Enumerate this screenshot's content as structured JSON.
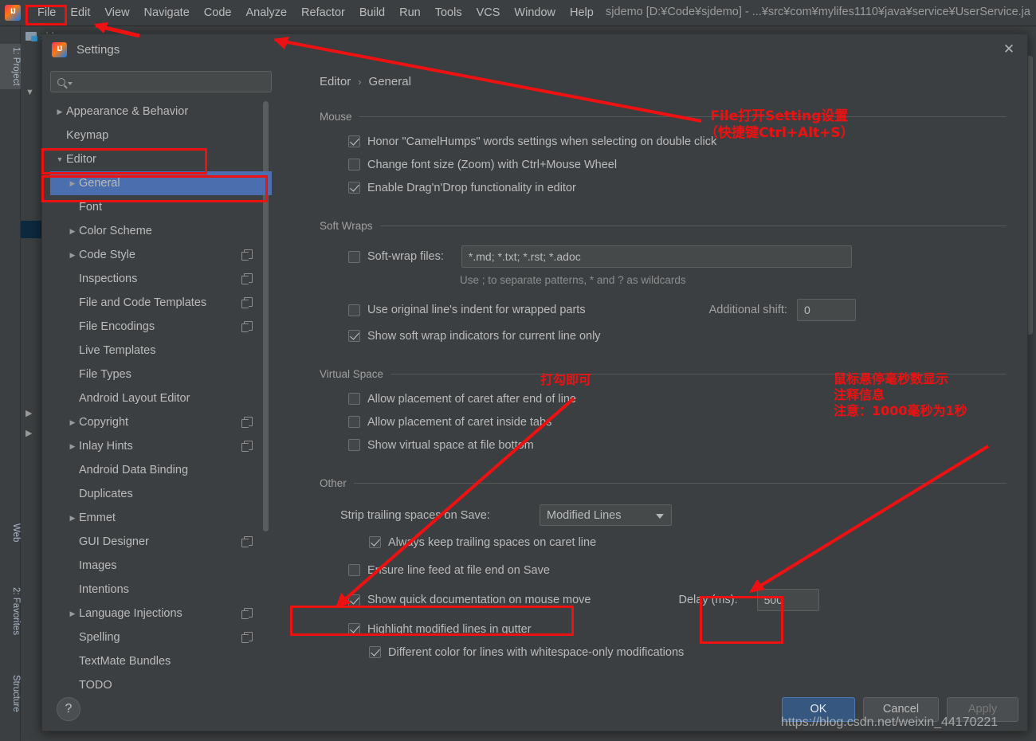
{
  "ide": {
    "menu": [
      {
        "label": "File",
        "mnemonic": "F"
      },
      {
        "label": "Edit",
        "mnemonic": "E"
      },
      {
        "label": "View",
        "mnemonic": "V"
      },
      {
        "label": "Navigate",
        "mnemonic": "N"
      },
      {
        "label": "Code",
        "mnemonic": "C"
      },
      {
        "label": "Analyze",
        "mnemonic": "z"
      },
      {
        "label": "Refactor",
        "mnemonic": "R"
      },
      {
        "label": "Build",
        "mnemonic": "B"
      },
      {
        "label": "Run",
        "mnemonic": "u"
      },
      {
        "label": "Tools",
        "mnemonic": "T"
      },
      {
        "label": "VCS",
        "mnemonic": ""
      },
      {
        "label": "Window",
        "mnemonic": "W"
      },
      {
        "label": "Help",
        "mnemonic": "H"
      }
    ],
    "window_title": "sjdemo [D:¥Code¥sjdemo] - ...¥src¥com¥mylifes1110¥java¥service¥UserService.ja",
    "project_tab_label": "sjd",
    "tool_windows": [
      {
        "label": "1: Project",
        "active": true
      },
      {
        "label": "Web",
        "active": false
      },
      {
        "label": "2: Favorites",
        "active": false
      },
      {
        "label": "Structure",
        "active": false
      }
    ]
  },
  "dialog": {
    "title": "Settings",
    "close_icon": "close-icon",
    "search": {
      "value": "",
      "placeholder": ""
    },
    "breadcrumb": {
      "root": "Editor",
      "separator": "›",
      "leaf": "General"
    },
    "tree": [
      {
        "label": "Appearance & Behavior",
        "depth": 0,
        "arrow": "▶",
        "copy": false,
        "selected": false
      },
      {
        "label": "Keymap",
        "depth": 0,
        "arrow": "",
        "copy": false,
        "selected": false
      },
      {
        "label": "Editor",
        "depth": 0,
        "arrow": "▼",
        "copy": false,
        "selected": false
      },
      {
        "label": "General",
        "depth": 1,
        "arrow": "▶",
        "copy": false,
        "selected": true
      },
      {
        "label": "Font",
        "depth": 1,
        "arrow": "",
        "copy": false,
        "selected": false
      },
      {
        "label": "Color Scheme",
        "depth": 1,
        "arrow": "▶",
        "copy": false,
        "selected": false
      },
      {
        "label": "Code Style",
        "depth": 1,
        "arrow": "▶",
        "copy": true,
        "selected": false
      },
      {
        "label": "Inspections",
        "depth": 1,
        "arrow": "",
        "copy": true,
        "selected": false
      },
      {
        "label": "File and Code Templates",
        "depth": 1,
        "arrow": "",
        "copy": true,
        "selected": false
      },
      {
        "label": "File Encodings",
        "depth": 1,
        "arrow": "",
        "copy": true,
        "selected": false
      },
      {
        "label": "Live Templates",
        "depth": 1,
        "arrow": "",
        "copy": false,
        "selected": false
      },
      {
        "label": "File Types",
        "depth": 1,
        "arrow": "",
        "copy": false,
        "selected": false
      },
      {
        "label": "Android Layout Editor",
        "depth": 1,
        "arrow": "",
        "copy": false,
        "selected": false
      },
      {
        "label": "Copyright",
        "depth": 1,
        "arrow": "▶",
        "copy": true,
        "selected": false
      },
      {
        "label": "Inlay Hints",
        "depth": 1,
        "arrow": "▶",
        "copy": true,
        "selected": false
      },
      {
        "label": "Android Data Binding",
        "depth": 1,
        "arrow": "",
        "copy": false,
        "selected": false
      },
      {
        "label": "Duplicates",
        "depth": 1,
        "arrow": "",
        "copy": false,
        "selected": false
      },
      {
        "label": "Emmet",
        "depth": 1,
        "arrow": "▶",
        "copy": false,
        "selected": false
      },
      {
        "label": "GUI Designer",
        "depth": 1,
        "arrow": "",
        "copy": true,
        "selected": false
      },
      {
        "label": "Images",
        "depth": 1,
        "arrow": "",
        "copy": false,
        "selected": false
      },
      {
        "label": "Intentions",
        "depth": 1,
        "arrow": "",
        "copy": false,
        "selected": false
      },
      {
        "label": "Language Injections",
        "depth": 1,
        "arrow": "▶",
        "copy": true,
        "selected": false
      },
      {
        "label": "Spelling",
        "depth": 1,
        "arrow": "",
        "copy": true,
        "selected": false
      },
      {
        "label": "TextMate Bundles",
        "depth": 1,
        "arrow": "",
        "copy": false,
        "selected": false
      },
      {
        "label": "TODO",
        "depth": 1,
        "arrow": "",
        "copy": false,
        "selected": false
      }
    ],
    "sections": {
      "mouse": {
        "title": "Mouse",
        "options": [
          {
            "label": "Honor \"CamelHumps\" words settings when selecting on double click",
            "checked": true
          },
          {
            "label": "Change font size (Zoom) with Ctrl+Mouse Wheel",
            "checked": false
          },
          {
            "label": "Enable Drag'n'Drop functionality in editor",
            "checked": true
          }
        ]
      },
      "soft_wraps": {
        "title": "Soft Wraps",
        "soft_wrap_files": {
          "label": "Soft-wrap files:",
          "checked": false,
          "value": "*.md; *.txt; *.rst; *.adoc"
        },
        "hint": "Use ; to separate patterns, * and ? as wildcards",
        "use_original_indent": {
          "label": "Use original line's indent for wrapped parts",
          "checked": false
        },
        "additional_shift": {
          "label": "Additional shift:",
          "value": "0"
        },
        "show_indicators": {
          "label": "Show soft wrap indicators for current line only",
          "checked": true
        }
      },
      "virtual_space": {
        "title": "Virtual Space",
        "options": [
          {
            "label": "Allow placement of caret after end of line",
            "checked": false
          },
          {
            "label": "Allow placement of caret inside tabs",
            "checked": false
          },
          {
            "label": "Show virtual space at file bottom",
            "checked": false
          }
        ]
      },
      "other": {
        "title": "Other",
        "strip_trailing": {
          "label": "Strip trailing spaces on Save:",
          "value": "Modified Lines"
        },
        "always_keep": {
          "label": "Always keep trailing spaces on caret line",
          "checked": true
        },
        "ensure_line_feed": {
          "label": "Ensure line feed at file end on Save",
          "checked": false
        },
        "quick_doc": {
          "label": "Show quick documentation on mouse move",
          "checked": true
        },
        "delay": {
          "label": "Delay (ms):",
          "value": "500"
        },
        "highlight_modified": {
          "label": "Highlight modified lines in gutter",
          "checked": true
        },
        "different_color": {
          "label": "Different color for lines with whitespace-only modifications",
          "checked": true
        }
      }
    },
    "footer": {
      "help_label": "?",
      "ok_label": "OK",
      "cancel_label": "Cancel",
      "apply_label": "Apply"
    }
  },
  "annotations": {
    "file_menu_note": "File打开Setting设置\n（快捷键Ctrl+Alt+S）",
    "check_note": "打勾即可",
    "delay_note": "鼠标悬停毫秒数显示\n注释信息\n注意：1000毫秒为1秒",
    "watermark": "https://blog.csdn.net/weixin_44170221",
    "color": "#ee1111"
  }
}
